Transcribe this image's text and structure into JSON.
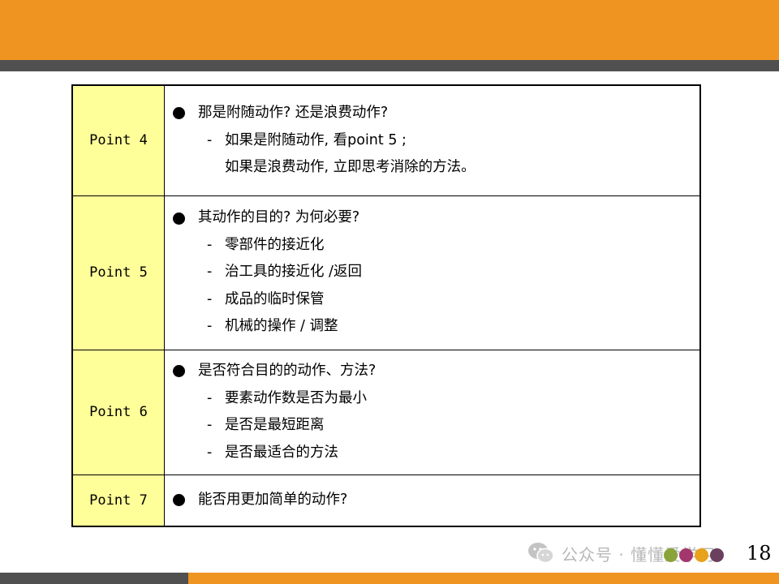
{
  "rows": [
    {
      "label": "Point 4",
      "bullet": "那是附随动作? 还是浪费动作?",
      "subs": [
        "如果是附随动作, 看point 5 ;"
      ],
      "continuation": "如果是浪费动作, 立即思考消除的方法。"
    },
    {
      "label": "Point 5",
      "bullet": "其动作的目的? 为何必要?",
      "subs": [
        "零部件的接近化",
        "治工具的接近化 /返回",
        "成品的临时保管",
        "机械的操作 / 调整"
      ]
    },
    {
      "label": "Point 6",
      "bullet": "是否符合目的的动作、方法?",
      "subs": [
        "要素动作数是否为最小",
        "是否是最短距离",
        "是否最适合的方法"
      ]
    },
    {
      "label": "Point 7",
      "bullet": "能否用更加简单的动作?",
      "subs": []
    }
  ],
  "dash": "-",
  "footer": {
    "watermark": "公众号 · 懂懂爱学习",
    "page_number": "18"
  },
  "colors": {
    "accent_orange": "#ef9420",
    "strip_gray": "#505050",
    "label_yellow": "#ffff99",
    "dot_colors": [
      "#8aa33a",
      "#a3376d",
      "#e8a21c",
      "#6b3f5e"
    ]
  }
}
